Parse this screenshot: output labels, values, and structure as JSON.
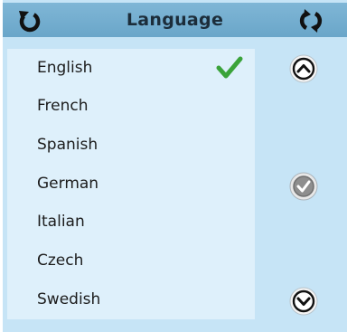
{
  "header": {
    "title": "Language",
    "back_icon": "back-icon",
    "refresh_icon": "refresh-icon"
  },
  "languages": [
    {
      "label": "English",
      "selected": true
    },
    {
      "label": "French",
      "selected": false
    },
    {
      "label": "Spanish",
      "selected": false
    },
    {
      "label": "German",
      "selected": false
    },
    {
      "label": "Italian",
      "selected": false
    },
    {
      "label": "Czech",
      "selected": false
    },
    {
      "label": "Swedish",
      "selected": false
    }
  ],
  "controls": {
    "scroll_up_icon": "chevron-up-icon",
    "confirm_icon": "check-circle-icon",
    "scroll_down_icon": "chevron-down-icon"
  },
  "colors": {
    "header": "#6aa6c9",
    "panel": "#c6e4f6",
    "list": "#def0fb",
    "check": "#3aa33a"
  }
}
